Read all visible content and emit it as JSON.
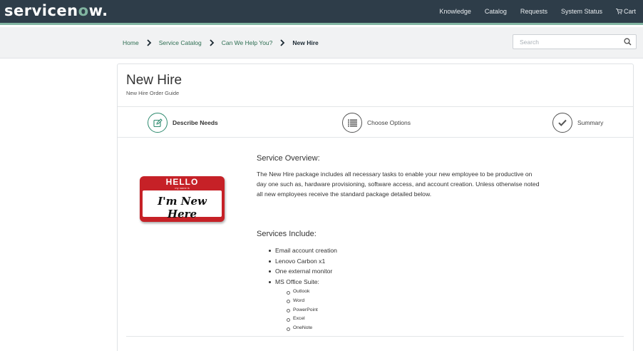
{
  "header": {
    "logo": {
      "pre": "servicen",
      "o": "o",
      "post": "w."
    },
    "nav": [
      "Knowledge",
      "Catalog",
      "Requests",
      "System Status",
      "Cart"
    ],
    "cart_icon": "cart-icon"
  },
  "breadcrumb": {
    "items": [
      "Home",
      "Service Catalog",
      "Can We Help You?"
    ],
    "current": "New Hire"
  },
  "search": {
    "placeholder": "Search",
    "icon": "search-icon"
  },
  "page": {
    "title": "New Hire",
    "subtitle": "New Hire Order Guide"
  },
  "steps": [
    {
      "label": "Describe Needs",
      "icon": "edit-icon",
      "state": "active"
    },
    {
      "label": "Choose Options",
      "icon": "list-icon",
      "state": "pending"
    },
    {
      "label": "Summary",
      "icon": "check-icon",
      "state": "pending"
    }
  ],
  "badge": {
    "top": "HELLO",
    "sub": "my name is",
    "name": "I'm New Here"
  },
  "overview": {
    "title": "Service Overview:",
    "text": "The New Hire package includes all necessary tasks to enable your new employee to be productive on day one such as, hardware provisioning, software access, and account creation.  Unless otherwise noted all new employees receive the standard package detailed below."
  },
  "services": {
    "title": "Services Include:",
    "items": [
      "Email account creation",
      "Lenovo Carbon x1",
      "One external monitor",
      "MS Office Suite:"
    ],
    "office_items": [
      "Outlook",
      "Word",
      "PowerPoint",
      "Excel",
      "OneNote"
    ]
  },
  "colors": {
    "header_bg": "#2e3d49",
    "accent": "#81b5a1",
    "active_step": "#2e8b6f",
    "link": "#2e6e52"
  }
}
